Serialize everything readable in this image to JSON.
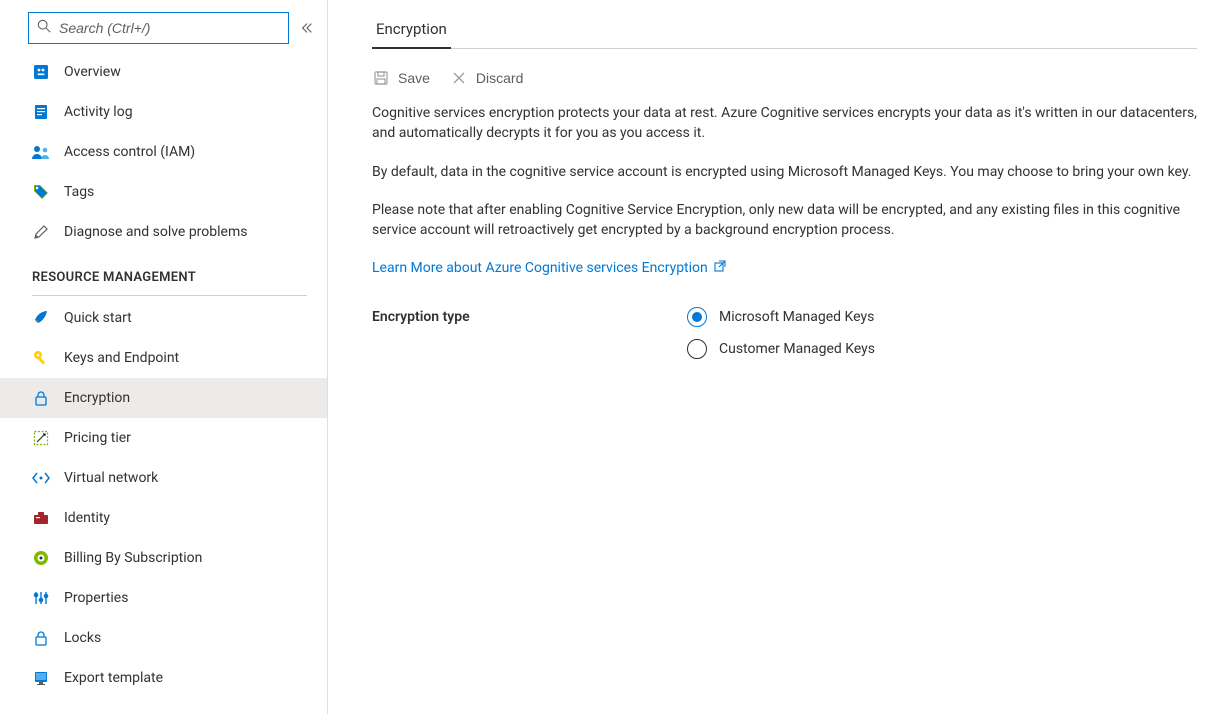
{
  "search": {
    "placeholder": "Search (Ctrl+/)"
  },
  "nav": {
    "top": [
      {
        "label": "Overview",
        "icon": "overview"
      },
      {
        "label": "Activity log",
        "icon": "activity-log"
      },
      {
        "label": "Access control (IAM)",
        "icon": "access-control"
      },
      {
        "label": "Tags",
        "icon": "tags"
      },
      {
        "label": "Diagnose and solve problems",
        "icon": "diagnose"
      }
    ],
    "section_header": "RESOURCE MANAGEMENT",
    "resource": [
      {
        "label": "Quick start",
        "icon": "quick-start"
      },
      {
        "label": "Keys and Endpoint",
        "icon": "keys"
      },
      {
        "label": "Encryption",
        "icon": "encryption",
        "selected": true
      },
      {
        "label": "Pricing tier",
        "icon": "pricing"
      },
      {
        "label": "Virtual network",
        "icon": "vnet"
      },
      {
        "label": "Identity",
        "icon": "identity"
      },
      {
        "label": "Billing By Subscription",
        "icon": "billing"
      },
      {
        "label": "Properties",
        "icon": "properties"
      },
      {
        "label": "Locks",
        "icon": "locks"
      },
      {
        "label": "Export template",
        "icon": "export"
      }
    ]
  },
  "tab": {
    "encryption": "Encryption"
  },
  "toolbar": {
    "save": "Save",
    "discard": "Discard"
  },
  "body": {
    "p1": "Cognitive services encryption protects your data at rest. Azure Cognitive services encrypts your data as it's written in our datacenters, and automatically decrypts it for you as you access it.",
    "p2": "By default, data in the cognitive service account is encrypted using Microsoft Managed Keys. You may choose to bring your own key.",
    "p3": "Please note that after enabling Cognitive Service Encryption, only new data will be encrypted, and any existing files in this cognitive service account will retroactively get encrypted by a background encryption process.",
    "link": "Learn More about Azure Cognitive services Encryption"
  },
  "form": {
    "label": "Encryption type",
    "options": {
      "msft": "Microsoft Managed Keys",
      "cust": "Customer Managed Keys"
    }
  }
}
